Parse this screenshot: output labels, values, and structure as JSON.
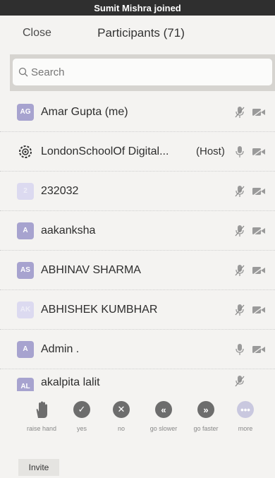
{
  "banner": {
    "text": "Sumit Mishra joined"
  },
  "header": {
    "close_label": "Close",
    "title": "Participants (71)"
  },
  "search": {
    "placeholder": "Search"
  },
  "participants": [
    {
      "initials": "AG",
      "name": "Amar Gupta (me)",
      "role": "",
      "mic": "muted",
      "video": "off"
    },
    {
      "initials": "",
      "name": "LondonSchoolOf Digital...",
      "role": "(Host)",
      "mic": "on",
      "video": "off"
    },
    {
      "initials": "2",
      "name": "232032",
      "role": "",
      "mic": "muted",
      "video": "off"
    },
    {
      "initials": "A",
      "name": "aakanksha",
      "role": "",
      "mic": "muted",
      "video": "off"
    },
    {
      "initials": "AS",
      "name": "ABHINAV SHARMA",
      "role": "",
      "mic": "muted",
      "video": "off"
    },
    {
      "initials": "AK",
      "name": "ABHISHEK KUMBHAR",
      "role": "",
      "mic": "muted",
      "video": "off"
    },
    {
      "initials": "A",
      "name": "Admin .",
      "role": "",
      "mic": "on",
      "video": "off"
    },
    {
      "initials": "AL",
      "name": "akalpita lalit",
      "role": "",
      "mic": "muted",
      "video": ""
    }
  ],
  "reactions": [
    {
      "icon": "raise-hand-icon",
      "label": "raise hand"
    },
    {
      "icon": "check-icon",
      "label": "yes"
    },
    {
      "icon": "x-icon",
      "label": "no"
    },
    {
      "icon": "rewind-icon",
      "label": "go slower"
    },
    {
      "icon": "fast-forward-icon",
      "label": "go faster"
    },
    {
      "icon": "more-icon",
      "label": "more"
    }
  ],
  "invite": {
    "label": "Invite"
  }
}
